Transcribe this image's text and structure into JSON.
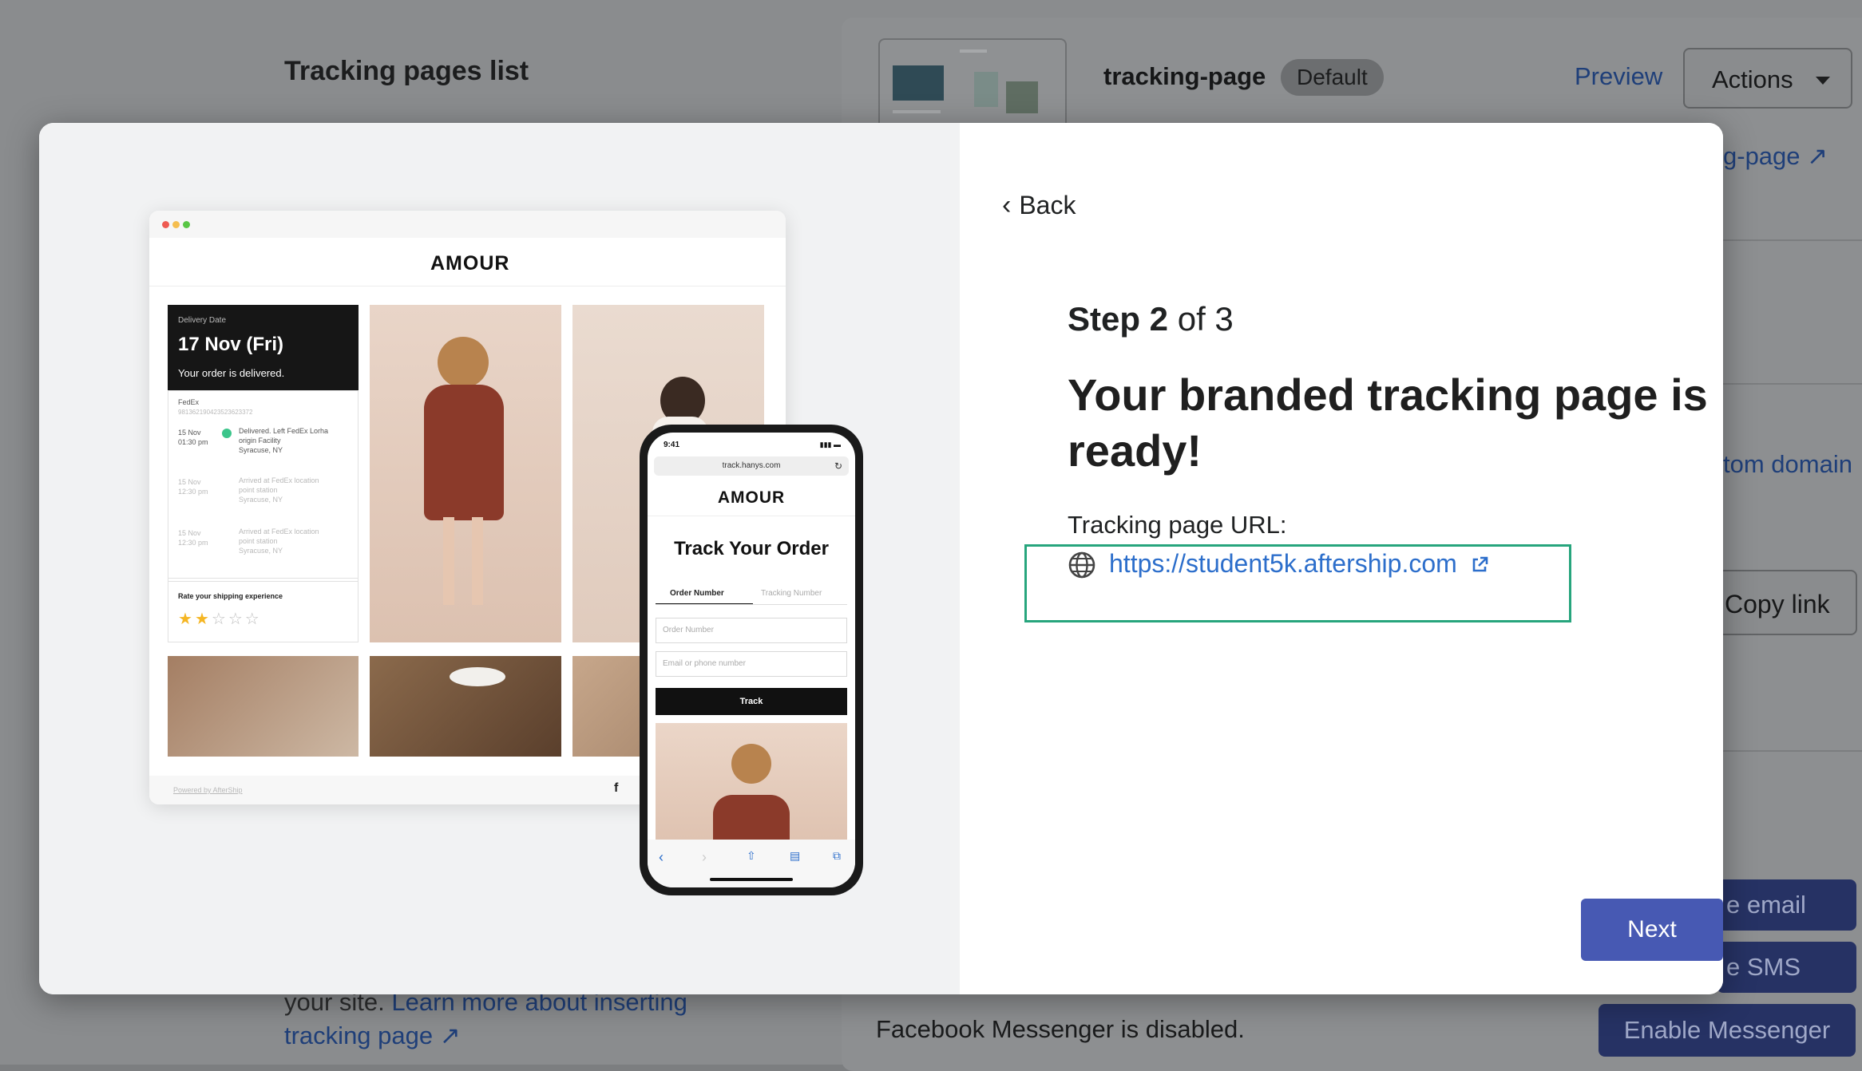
{
  "background": {
    "list_title": "Tracking pages list",
    "page_name": "tracking-page",
    "default_badge": "Default",
    "preview_link": "Preview",
    "actions_button": "Actions",
    "page_link_fragment": "g-page",
    "custom_domain_fragment": "tom domain",
    "copy_link_fragment": "Copy link",
    "email_button_fragment": "e email",
    "sms_button_fragment": "e SMS",
    "insert_text": "your site.",
    "insert_link_1": "Learn more about inserting",
    "insert_link_2": "tracking page",
    "messenger_text": "Facebook Messenger is disabled.",
    "enable_messenger_button": "Enable Messenger"
  },
  "preview": {
    "desktop": {
      "brand": "AMOUR",
      "delivery_label": "Delivery Date",
      "delivery_date": "17 Nov (Fri)",
      "delivery_status": "Your order is delivered.",
      "carrier": "FedEx",
      "tracking_number": "981362190423523623372",
      "events": [
        {
          "date": "15 Nov",
          "time": "01:30 pm",
          "text1": "Delivered. Left FedEx Lorha",
          "text2": "origin Facility",
          "text3": "Syracuse, NY"
        },
        {
          "date": "15 Nov",
          "time": "12:30 pm",
          "text1": "Arrived at FedEx location",
          "text2": "point station",
          "text3": "Syracuse, NY"
        },
        {
          "date": "15 Nov",
          "time": "12:30 pm",
          "text1": "Arrived at FedEx location",
          "text2": "point station",
          "text3": "Syracuse, NY"
        }
      ],
      "rate_label": "Rate your shipping experience",
      "rating": 2,
      "rating_max": 5,
      "powered_by": "Powered by AfterShip",
      "social_icon": "f"
    },
    "phone": {
      "time": "9:41",
      "address": "track.hanys.com",
      "brand": "AMOUR",
      "title": "Track Your Order",
      "tab_order": "Order Number",
      "tab_tracking": "Tracking Number",
      "order_placeholder": "Order Number",
      "email_placeholder": "Email or phone number",
      "track_button": "Track"
    }
  },
  "dialog": {
    "back_label": "Back",
    "step_strong": "Step 2",
    "step_rest": " of 3",
    "headline": "Your branded tracking page is ready!",
    "url_label": "Tracking page URL:",
    "url": "https://student5k.aftership.com",
    "next_label": "Next"
  },
  "colors": {
    "accent_button": "#4759b3",
    "link": "#2c6ecb",
    "highlight_border": "#27a57d"
  }
}
